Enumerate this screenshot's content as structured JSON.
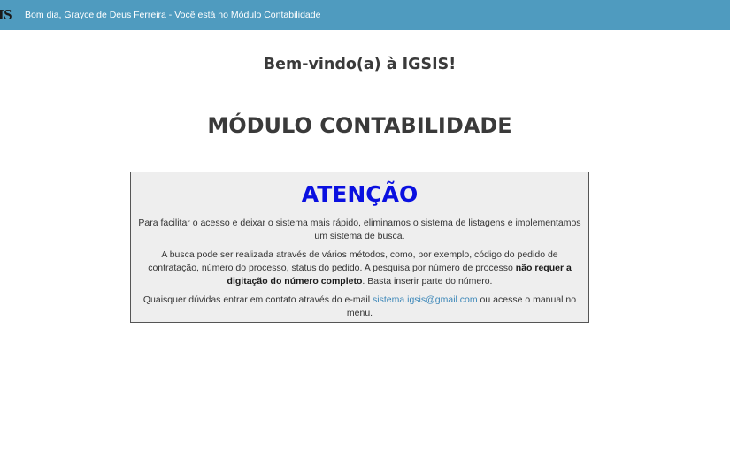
{
  "header": {
    "logo_text": "IS",
    "greeting": "Bom dia, Grayce de Deus Ferreira - Você está no Módulo Contabilidade"
  },
  "main": {
    "welcome": "Bem-vindo(a) à IGSIS!",
    "module_title": "MÓDULO CONTABILIDADE"
  },
  "notice": {
    "title": "ATENÇÃO",
    "paragraph1": "Para facilitar o acesso e deixar o sistema mais rápido, eliminamos o sistema de listagens e implementamos um sistema de busca.",
    "paragraph2_part1": "A busca pode ser realizada através de vários métodos, como, por exemplo, código do pedido de contratação, número do processo, status do pedido. A pesquisa por número de processo ",
    "paragraph2_bold": "não requer a digitação do número completo",
    "paragraph2_part2": ". Basta inserir parte do número.",
    "paragraph3_part1": "Quaisquer dúvidas entrar em contato através do e-mail ",
    "email": "sistema.igsis@gmail.com",
    "paragraph3_part2": " ou acesse o manual no menu."
  },
  "colors": {
    "topbar": "#4f9bbf",
    "notice_title": "#0a10e0",
    "link": "#3a86b8",
    "notice_background": "#eeeeee"
  }
}
